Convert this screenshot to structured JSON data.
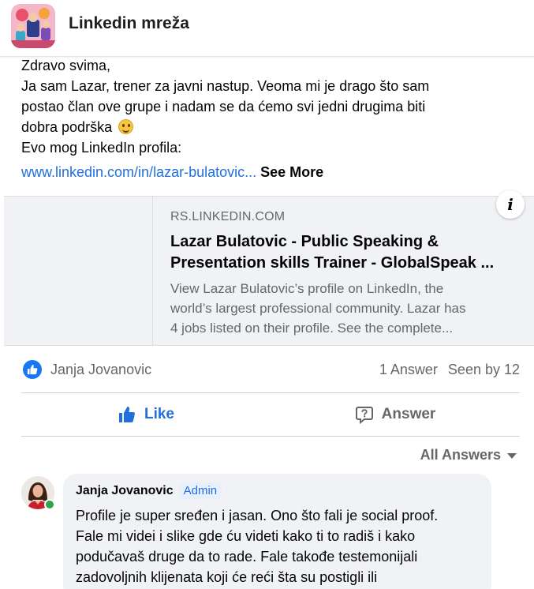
{
  "header": {
    "group_name": "Linkedin mreža"
  },
  "post": {
    "lines": [
      "Zdravo svima,",
      "Ja sam Lazar, trener za javni nastup. Veoma mi je drago što sam",
      "postao član ove grupe i nadam se da ćemo svi jedni drugima biti",
      "dobra podrška",
      "Evo mog LinkedIn profila:"
    ],
    "link_text": "www.linkedin.com/in/lazar-bulatovic...",
    "see_more": "See More"
  },
  "link_preview": {
    "domain": "RS.LINKEDIN.COM",
    "title_lines": [
      "Lazar Bulatovic - Public Speaking &",
      "Presentation skills Trainer - GlobalSpeak ..."
    ],
    "description_lines": [
      "View Lazar Bulatovic’s profile on LinkedIn, the",
      "world’s largest professional community. Lazar has",
      "4 jobs listed on their profile. See the complete..."
    ],
    "info_icon": "i"
  },
  "stats": {
    "reactor_name": "Janja Jovanovic",
    "answers": "1 Answer",
    "seen_by": "Seen by 12"
  },
  "actions": {
    "like_label": "Like",
    "answer_label": "Answer"
  },
  "answers_filter": {
    "label": "All Answers"
  },
  "comment": {
    "author": "Janja Jovanovic",
    "badge": "Admin",
    "lines": [
      "Profile je super sređen i jasan. Ono što fali je social proof.",
      "Fale mi videi i slike gde ću videti kako ti to radiš i kako",
      "podučavaš druge da to rade. Fale takođe testemonijali",
      "zadovoljnih klijenata koji će reći šta su postigli ili"
    ]
  },
  "colors": {
    "accent": "#216fdb",
    "like_blue": "#1877f2",
    "muted_text": "#65676b",
    "bubble_bg": "#f0f2f5",
    "online_green": "#31a24c"
  }
}
